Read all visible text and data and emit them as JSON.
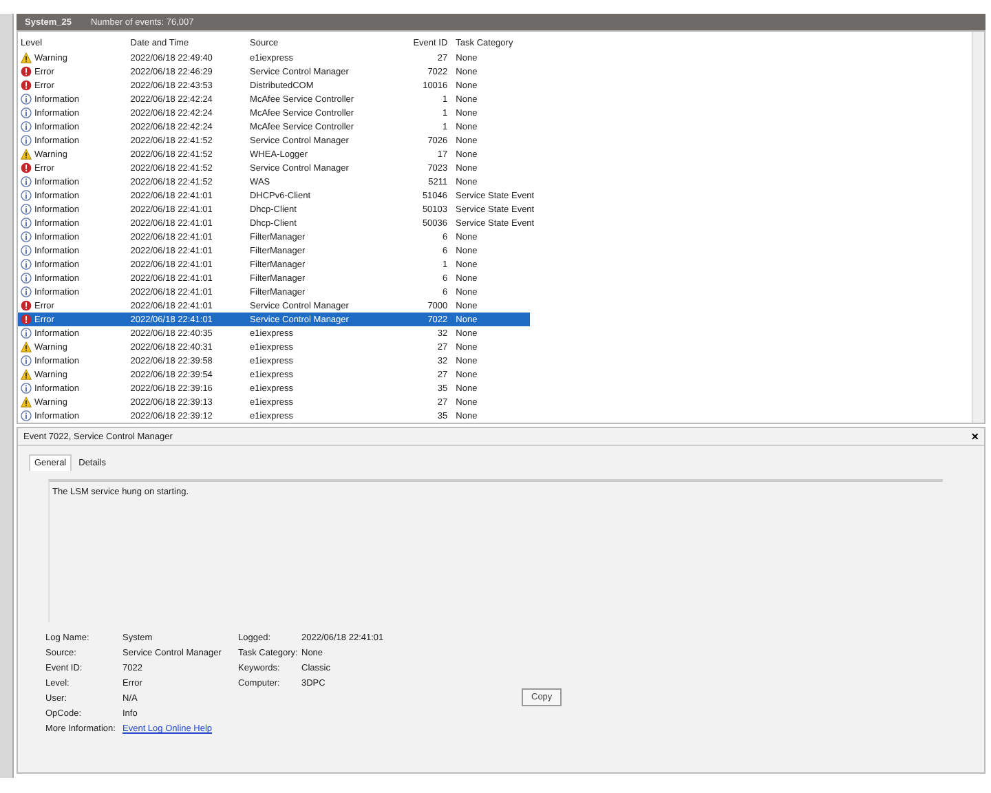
{
  "log_title": {
    "name": "System_25",
    "count": "Number of events: 76,007"
  },
  "table": {
    "columns": [
      "Level",
      "Date and Time",
      "Source",
      "Event ID",
      "Task Category"
    ],
    "rows": [
      {
        "kind": "warning",
        "level": "Warning",
        "date": "2022/06/18 22:49:40",
        "source": "e1iexpress",
        "event_id": "27",
        "task": "None",
        "selected": false
      },
      {
        "kind": "error",
        "level": "Error",
        "date": "2022/06/18 22:46:29",
        "source": "Service Control Manager",
        "event_id": "7022",
        "task": "None",
        "selected": false
      },
      {
        "kind": "error",
        "level": "Error",
        "date": "2022/06/18 22:43:53",
        "source": "DistributedCOM",
        "event_id": "10016",
        "task": "None",
        "selected": false
      },
      {
        "kind": "info",
        "level": "Information",
        "date": "2022/06/18 22:42:24",
        "source": "McAfee Service Controller",
        "event_id": "1",
        "task": "None",
        "selected": false
      },
      {
        "kind": "info",
        "level": "Information",
        "date": "2022/06/18 22:42:24",
        "source": "McAfee Service Controller",
        "event_id": "1",
        "task": "None",
        "selected": false
      },
      {
        "kind": "info",
        "level": "Information",
        "date": "2022/06/18 22:42:24",
        "source": "McAfee Service Controller",
        "event_id": "1",
        "task": "None",
        "selected": false
      },
      {
        "kind": "info",
        "level": "Information",
        "date": "2022/06/18 22:41:52",
        "source": "Service Control Manager",
        "event_id": "7026",
        "task": "None",
        "selected": false
      },
      {
        "kind": "warning",
        "level": "Warning",
        "date": "2022/06/18 22:41:52",
        "source": "WHEA-Logger",
        "event_id": "17",
        "task": "None",
        "selected": false
      },
      {
        "kind": "error",
        "level": "Error",
        "date": "2022/06/18 22:41:52",
        "source": "Service Control Manager",
        "event_id": "7023",
        "task": "None",
        "selected": false
      },
      {
        "kind": "info",
        "level": "Information",
        "date": "2022/06/18 22:41:52",
        "source": "WAS",
        "event_id": "5211",
        "task": "None",
        "selected": false
      },
      {
        "kind": "info",
        "level": "Information",
        "date": "2022/06/18 22:41:01",
        "source": "DHCPv6-Client",
        "event_id": "51046",
        "task": "Service State Event",
        "selected": false
      },
      {
        "kind": "info",
        "level": "Information",
        "date": "2022/06/18 22:41:01",
        "source": "Dhcp-Client",
        "event_id": "50103",
        "task": "Service State Event",
        "selected": false
      },
      {
        "kind": "info",
        "level": "Information",
        "date": "2022/06/18 22:41:01",
        "source": "Dhcp-Client",
        "event_id": "50036",
        "task": "Service State Event",
        "selected": false
      },
      {
        "kind": "info",
        "level": "Information",
        "date": "2022/06/18 22:41:01",
        "source": "FilterManager",
        "event_id": "6",
        "task": "None",
        "selected": false
      },
      {
        "kind": "info",
        "level": "Information",
        "date": "2022/06/18 22:41:01",
        "source": "FilterManager",
        "event_id": "6",
        "task": "None",
        "selected": false
      },
      {
        "kind": "info",
        "level": "Information",
        "date": "2022/06/18 22:41:01",
        "source": "FilterManager",
        "event_id": "1",
        "task": "None",
        "selected": false
      },
      {
        "kind": "info",
        "level": "Information",
        "date": "2022/06/18 22:41:01",
        "source": "FilterManager",
        "event_id": "6",
        "task": "None",
        "selected": false
      },
      {
        "kind": "info",
        "level": "Information",
        "date": "2022/06/18 22:41:01",
        "source": "FilterManager",
        "event_id": "6",
        "task": "None",
        "selected": false
      },
      {
        "kind": "error",
        "level": "Error",
        "date": "2022/06/18 22:41:01",
        "source": "Service Control Manager",
        "event_id": "7000",
        "task": "None",
        "selected": false
      },
      {
        "kind": "error",
        "level": "Error",
        "date": "2022/06/18 22:41:01",
        "source": "Service Control Manager",
        "event_id": "7022",
        "task": "None",
        "selected": true
      },
      {
        "kind": "info",
        "level": "Information",
        "date": "2022/06/18 22:40:35",
        "source": "e1iexpress",
        "event_id": "32",
        "task": "None",
        "selected": false
      },
      {
        "kind": "warning",
        "level": "Warning",
        "date": "2022/06/18 22:40:31",
        "source": "e1iexpress",
        "event_id": "27",
        "task": "None",
        "selected": false
      },
      {
        "kind": "info",
        "level": "Information",
        "date": "2022/06/18 22:39:58",
        "source": "e1iexpress",
        "event_id": "32",
        "task": "None",
        "selected": false
      },
      {
        "kind": "warning",
        "level": "Warning",
        "date": "2022/06/18 22:39:54",
        "source": "e1iexpress",
        "event_id": "27",
        "task": "None",
        "selected": false
      },
      {
        "kind": "info",
        "level": "Information",
        "date": "2022/06/18 22:39:16",
        "source": "e1iexpress",
        "event_id": "35",
        "task": "None",
        "selected": false
      },
      {
        "kind": "warning",
        "level": "Warning",
        "date": "2022/06/18 22:39:13",
        "source": "e1iexpress",
        "event_id": "27",
        "task": "None",
        "selected": false
      },
      {
        "kind": "info",
        "level": "Information",
        "date": "2022/06/18 22:39:12",
        "source": "e1iexpress",
        "event_id": "35",
        "task": "None",
        "selected": false
      }
    ]
  },
  "details": {
    "title": "Event 7022, Service Control Manager",
    "close": "×",
    "tabs": [
      {
        "label": "General",
        "selected": true
      },
      {
        "label": "Details",
        "selected": false
      }
    ],
    "description": "The LSM service hung on starting.",
    "fields_left": [
      {
        "label": "Log Name:",
        "value": "System"
      },
      {
        "label": "Source:",
        "value": "Service Control Manager"
      },
      {
        "label": "Event ID:",
        "value": "7022"
      },
      {
        "label": "Level:",
        "value": "Error"
      },
      {
        "label": "User:",
        "value": "N/A"
      },
      {
        "label": "OpCode:",
        "value": "Info"
      }
    ],
    "fields_right": [
      {
        "label": "Logged:",
        "value": "2022/06/18 22:41:01"
      },
      {
        "label": "Task Category:",
        "value": "None"
      },
      {
        "label": "Keywords:",
        "value": "Classic"
      },
      {
        "label": "Computer:",
        "value": "3DPC"
      }
    ],
    "more_info_label": "More Information:",
    "more_info_link": "Event Log Online Help",
    "copy_button": "Copy"
  }
}
